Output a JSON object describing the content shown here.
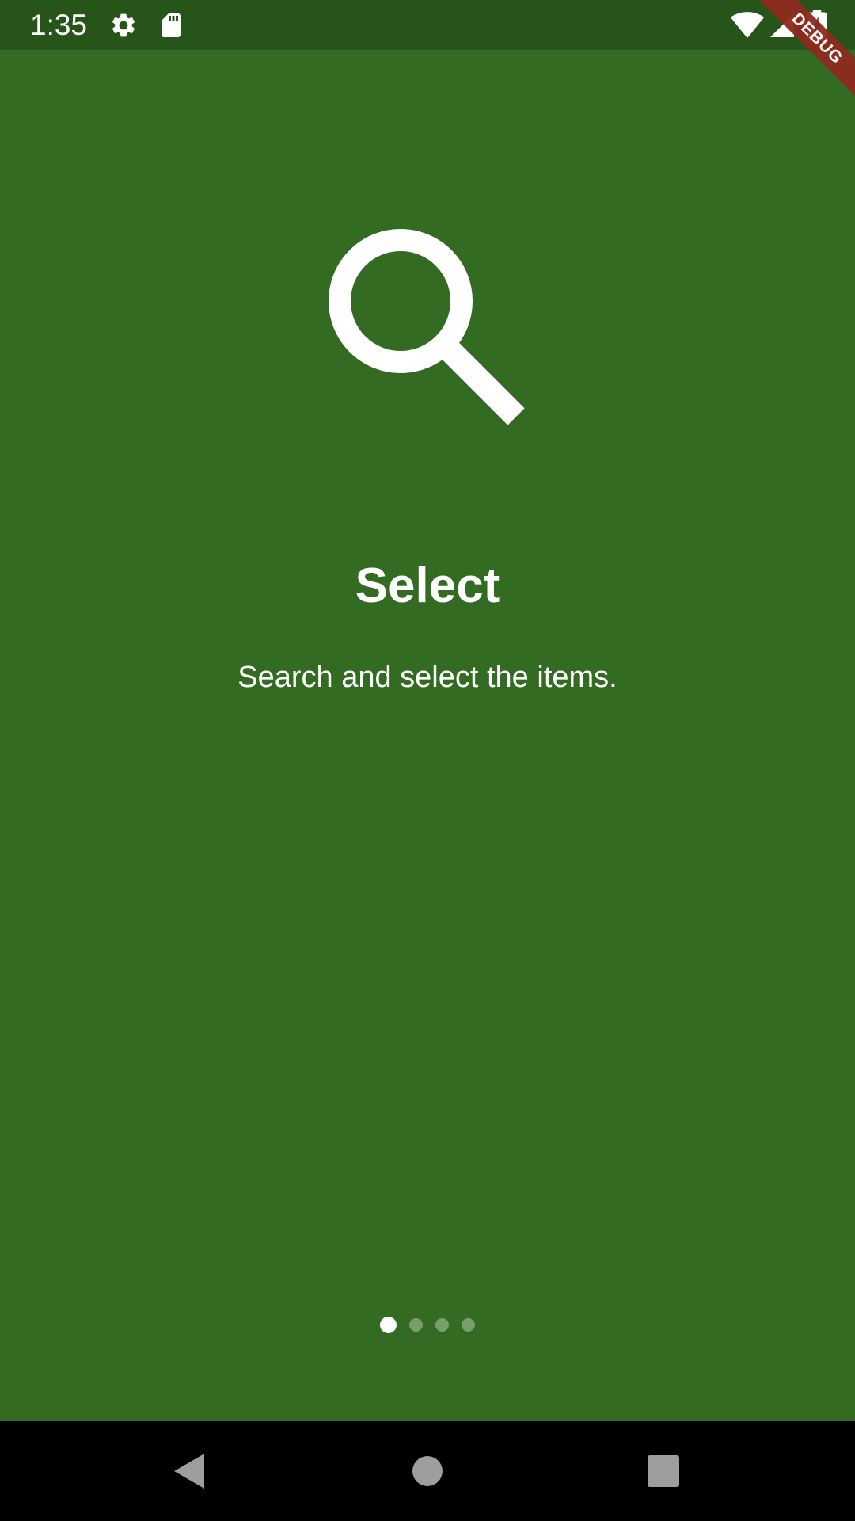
{
  "status_bar": {
    "time": "1:35",
    "icons": [
      "gear-icon",
      "sd-card-icon",
      "wifi-icon",
      "signal-icon",
      "battery-charging-icon"
    ]
  },
  "debug_banner": {
    "label": "DEBUG",
    "color": "#8E2A1F"
  },
  "onboarding": {
    "icon": "search-icon",
    "title": "Select",
    "subtitle": "Search and select the items.",
    "background_color": "#326B21",
    "page_indicator": {
      "current_page": 1,
      "total_pages": 4
    }
  },
  "nav_bar": {
    "buttons": [
      "back-icon",
      "home-icon",
      "recents-icon"
    ]
  }
}
